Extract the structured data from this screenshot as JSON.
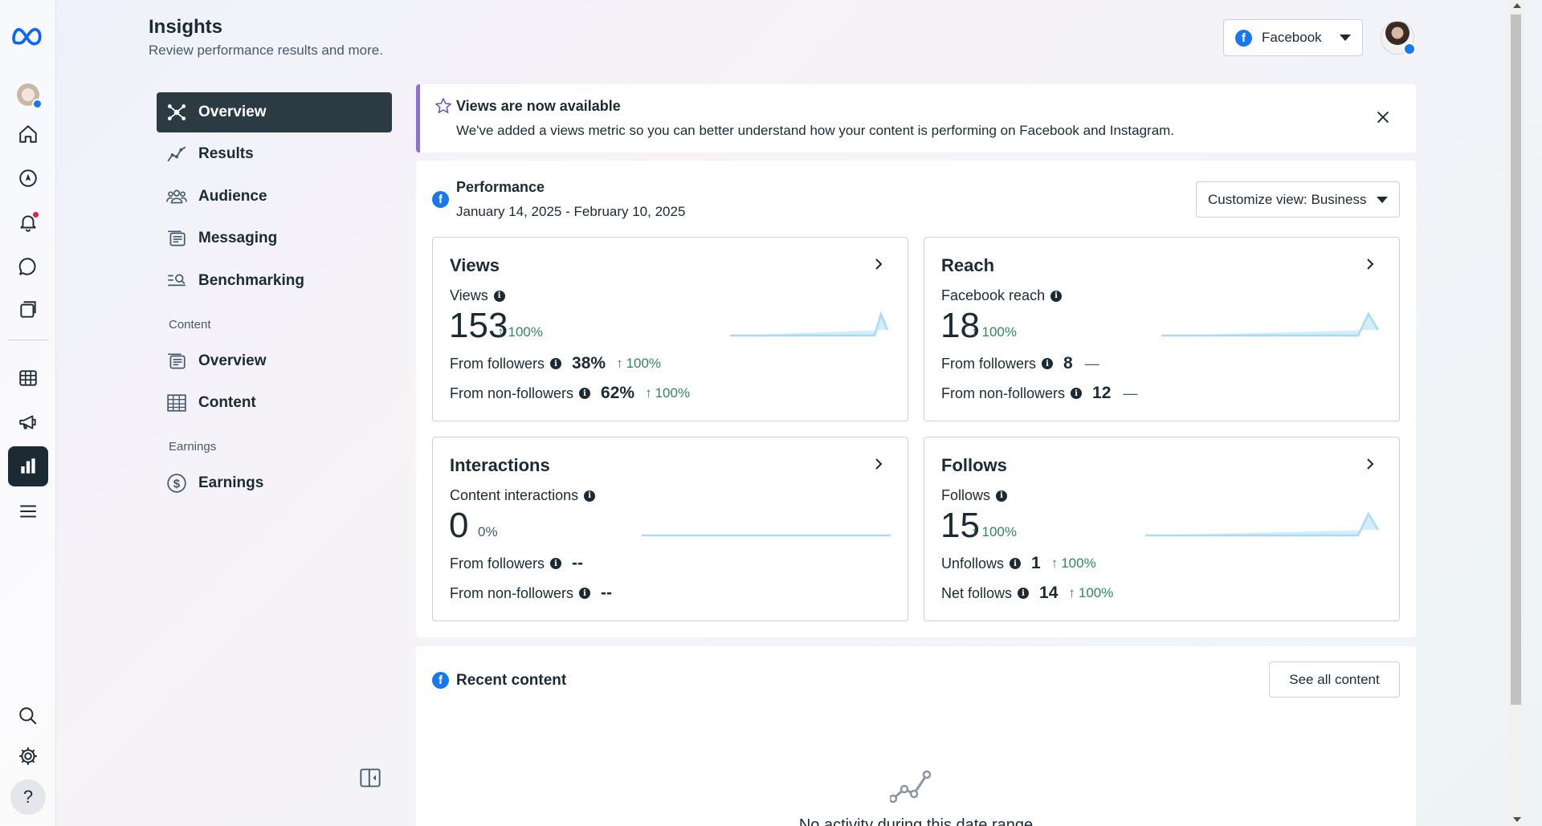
{
  "header": {
    "title": "Insights",
    "subtitle": "Review performance results and more.",
    "platform_label": "Facebook"
  },
  "sidebar": {
    "items": [
      {
        "label": "Overview",
        "icon": "overview-icon",
        "active": true
      },
      {
        "label": "Results",
        "icon": "results-icon"
      },
      {
        "label": "Audience",
        "icon": "audience-icon"
      },
      {
        "label": "Messaging",
        "icon": "messaging-icon"
      },
      {
        "label": "Benchmarking",
        "icon": "benchmarking-icon"
      }
    ],
    "content_section": "Content",
    "content_items": [
      {
        "label": "Overview",
        "icon": "content-overview-icon"
      },
      {
        "label": "Content",
        "icon": "table-icon"
      }
    ],
    "earnings_section": "Earnings",
    "earnings_items": [
      {
        "label": "Earnings",
        "icon": "dollar-icon"
      }
    ]
  },
  "banner": {
    "title": "Views are now available",
    "text": "We've added a views metric so you can better understand how your content is performing on Facebook and Instagram."
  },
  "performance": {
    "title": "Performance",
    "date_range": "January 14, 2025 - February 10, 2025",
    "customize_label": "Customize view: Business",
    "cards": {
      "views": {
        "title": "Views",
        "metric_label": "Views",
        "value": "153",
        "delta": "100%",
        "row1_label": "From followers",
        "row1_value": "38%",
        "row1_delta": "100%",
        "row2_label": "From non-followers",
        "row2_value": "62%",
        "row2_delta": "100%"
      },
      "reach": {
        "title": "Reach",
        "metric_label": "Facebook reach",
        "value": "18",
        "delta": "100%",
        "row1_label": "From followers",
        "row1_value": "8",
        "row1_delta": "—",
        "row2_label": "From non-followers",
        "row2_value": "12",
        "row2_delta": "—"
      },
      "interactions": {
        "title": "Interactions",
        "metric_label": "Content interactions",
        "value": "0",
        "delta": "0%",
        "row1_label": "From followers",
        "row1_value": "--",
        "row2_label": "From non-followers",
        "row2_value": "--"
      },
      "follows": {
        "title": "Follows",
        "metric_label": "Follows",
        "value": "15",
        "delta": "100%",
        "row1_label": "Unfollows",
        "row1_value": "1",
        "row1_delta": "100%",
        "row2_label": "Net follows",
        "row2_value": "14",
        "row2_delta": "100%"
      }
    }
  },
  "recent": {
    "title": "Recent content",
    "see_all_label": "See all content",
    "empty_text": "No activity during this date range"
  },
  "colors": {
    "accent": "#1877f2",
    "active_nav": "#2c3a43",
    "positive": "#2e8a57",
    "banner_border": "#8e6fd6",
    "spark": "#a8dcf3"
  }
}
